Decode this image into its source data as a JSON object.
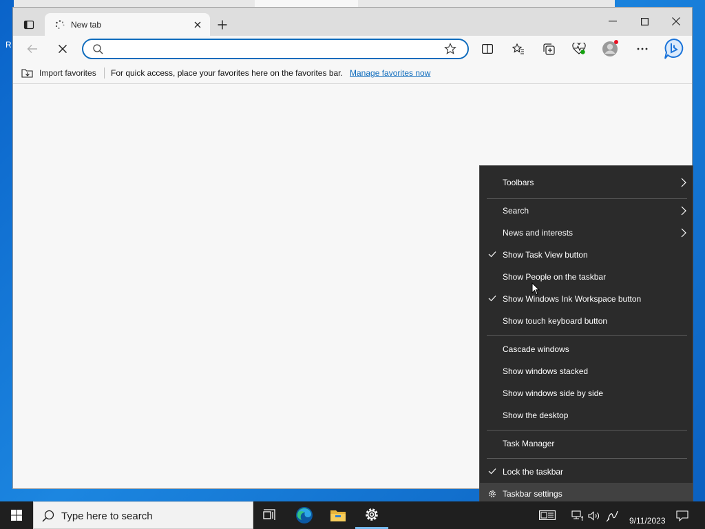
{
  "desktop": {
    "edge_text": "R"
  },
  "browser": {
    "tab": {
      "title": "New tab"
    },
    "address": {
      "value": "",
      "placeholder": ""
    },
    "favorites_bar": {
      "import_label": "Import favorites",
      "message": "For quick access, place your favorites here on the favorites bar.",
      "manage_link": "Manage favorites now"
    }
  },
  "context_menu": {
    "items": [
      {
        "label": "Toolbars",
        "submenu": true
      },
      {
        "label": "Search",
        "submenu": true
      },
      {
        "label": "News and interests",
        "submenu": true
      },
      {
        "label": "Show Task View button",
        "checked": true
      },
      {
        "label": "Show People on the taskbar",
        "checked": false
      },
      {
        "label": "Show Windows Ink Workspace button",
        "checked": true
      },
      {
        "label": "Show touch keyboard button",
        "checked": false
      },
      {
        "label": "Cascade windows"
      },
      {
        "label": "Show windows stacked"
      },
      {
        "label": "Show windows side by side"
      },
      {
        "label": "Show the desktop"
      },
      {
        "label": "Task Manager"
      },
      {
        "label": "Lock the taskbar",
        "checked": true
      },
      {
        "label": "Taskbar settings",
        "icon": "gear-icon",
        "highlighted": true
      }
    ]
  },
  "taskbar": {
    "search_placeholder": "Type here to search",
    "pinned_apps": [
      "task-view-icon",
      "edge-icon",
      "file-explorer-icon",
      "settings-icon"
    ],
    "active_app": "settings-icon",
    "clock": {
      "time": "",
      "date": "9/11/2023"
    }
  },
  "colors": {
    "accent": "#0f6cbd",
    "menu_bg": "#2b2b2b",
    "menu_highlight": "#414141",
    "taskbar_bg": "#1f1f1f"
  }
}
